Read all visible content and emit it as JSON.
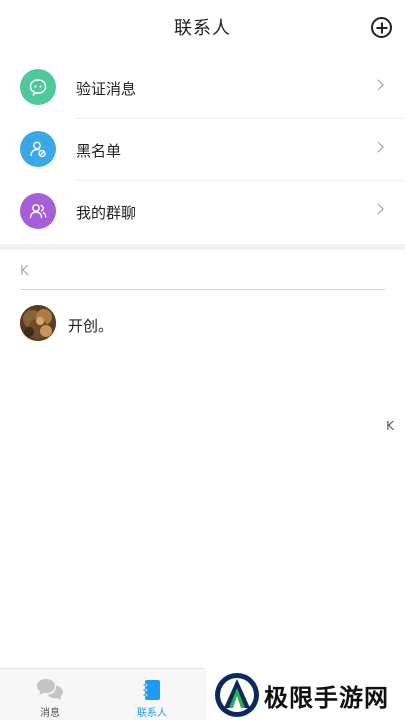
{
  "header": {
    "title": "联系人"
  },
  "menu": [
    {
      "label": "验证消息",
      "color": "#4fc99b",
      "icon": "chat-bubble-icon"
    },
    {
      "label": "黑名单",
      "color": "#3aa7e6",
      "icon": "user-blocked-icon"
    },
    {
      "label": "我的群聊",
      "color": "#a65fd6",
      "icon": "group-users-icon"
    }
  ],
  "contacts": {
    "section_letter": "K",
    "items": [
      {
        "name": "开创。"
      }
    ]
  },
  "index_bar": {
    "letters": [
      "K"
    ]
  },
  "tabbar": {
    "tabs": [
      {
        "label": "消息",
        "icon": "chat-bubbles-icon",
        "active": false
      },
      {
        "label": "联系人",
        "icon": "contacts-book-icon",
        "active": true
      }
    ],
    "active_color": "#1e9bf0",
    "inactive_color": "#aaaaaa"
  },
  "watermark": {
    "text": "极限手游网"
  }
}
